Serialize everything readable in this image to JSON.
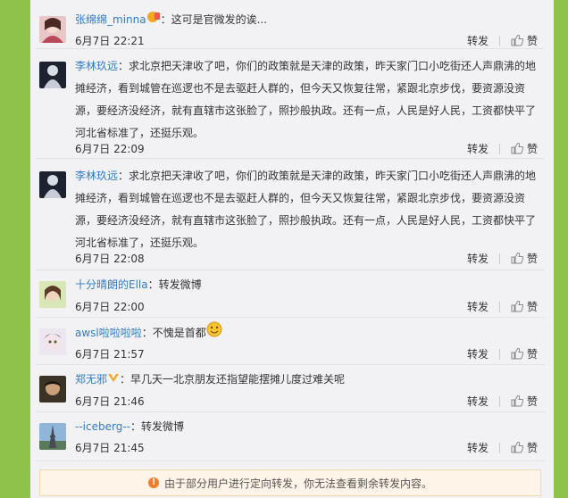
{
  "comments": [
    {
      "user": "张绵绵_minna",
      "sep": "：",
      "text": "这可是官微发的诶...",
      "time": "6月7日 22:21",
      "repost": "转发",
      "like": "赞"
    },
    {
      "user": "李林玖远",
      "sep": "：",
      "text": "求北京把天津收了吧，你们的政策就是天津的政策，昨天家门口小吃街还人声鼎沸的地摊经济，看到城管在巡逻也不是去驱赶人群的，但今天又恢复往常，紧跟北京步伐，要资源没资源，要经济没经济，就有直辖市这张脸了，照抄般执政。还有一点，人民是好人民，工资都快平了河北省标准了，还挺乐观。",
      "time": "6月7日 22:09",
      "repost": "转发",
      "like": "赞"
    },
    {
      "user": "李林玖远",
      "sep": "：",
      "text": "求北京把天津收了吧，你们的政策就是天津的政策，昨天家门口小吃街还人声鼎沸的地摊经济，看到城管在巡逻也不是去驱赶人群的，但今天又恢复往常，紧跟北京步伐，要资源没资源，要经济没经济，就有直辖市这张脸了，照抄般执政。还有一点，人民是好人民，工资都快平了河北省标准了，还挺乐观。",
      "time": "6月7日 22:08",
      "repost": "转发",
      "like": "赞"
    },
    {
      "user": "十分晴朗的Ella",
      "sep": "：",
      "text": "转发微博",
      "time": "6月7日 22:00",
      "repost": "转发",
      "like": "赞"
    },
    {
      "user": "awsl啦啦啦啦",
      "sep": "：",
      "text": "不愧是首都",
      "time": "6月7日 21:57",
      "repost": "转发",
      "like": "赞"
    },
    {
      "user": "郑无邪",
      "sep": "：",
      "text": "早几天一北京朋友还指望能摆摊儿度过难关呢",
      "time": "6月7日 21:46",
      "repost": "转发",
      "like": "赞"
    },
    {
      "user": "--iceberg--",
      "sep": "：",
      "text": "转发微博",
      "time": "6月7日 21:45",
      "repost": "转发",
      "like": "赞"
    }
  ],
  "notice": {
    "text": "由于部分用户进行定向转发，你无法查看剩余转发内容。"
  },
  "icons": {
    "like": "thumbs-up-icon",
    "vip": "vip-badge-icon",
    "warning": "warning-icon"
  },
  "colors": {
    "username": "#2f7cc6",
    "background": "#8fc24a",
    "panel": "#f2f2f5",
    "vip": "#f5a623"
  }
}
